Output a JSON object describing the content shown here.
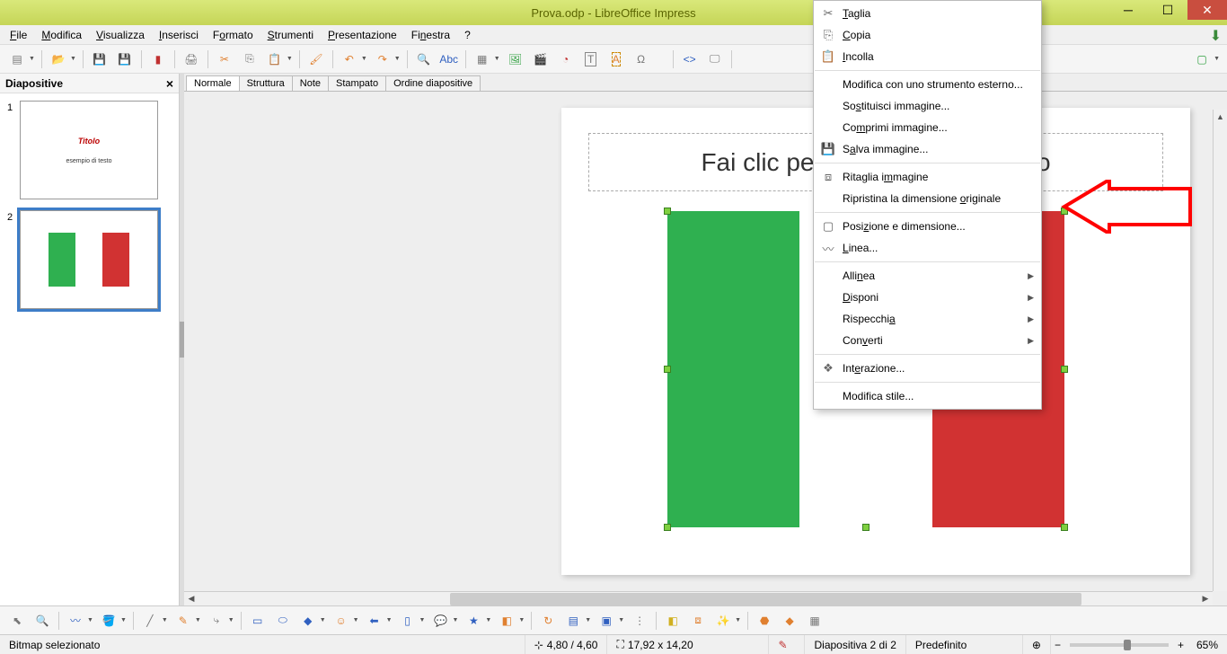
{
  "window": {
    "title": "Prova.odp - LibreOffice Impress"
  },
  "menu": {
    "file": "File",
    "edit": "Modifica",
    "view": "Visualizza",
    "insert": "Inserisci",
    "format": "Formato",
    "tools": "Strumenti",
    "presentation": "Presentazione",
    "window": "Finestra",
    "help": "?"
  },
  "panel": {
    "slides_title": "Diapositive",
    "close": "×"
  },
  "thumbs": {
    "s1_num": "1",
    "s1_title": "Titolo",
    "s1_sub": "esempio di testo",
    "s2_num": "2"
  },
  "tabs": {
    "normal": "Normale",
    "outline": "Struttura",
    "notes": "Note",
    "handout": "Stampato",
    "sorter": "Ordine diapositive"
  },
  "slide": {
    "title_placeholder": "Fai clic per aggiungere un titolo"
  },
  "ctx": {
    "cut": "Taglia",
    "copy": "Copia",
    "paste": "Incolla",
    "edit_ext": "Modifica con uno strumento esterno...",
    "replace": "Sostituisci immagine...",
    "compress": "Comprimi immagine...",
    "save": "Salva immagine...",
    "crop": "Ritaglia immagine",
    "orig": "Ripristina la dimensione originale",
    "pos": "Posizione e dimensione...",
    "line": "Linea...",
    "align": "Allinea",
    "arrange": "Disponi",
    "mirror": "Rispecchia",
    "convert": "Converti",
    "interaction": "Interazione...",
    "style": "Modifica stile..."
  },
  "status": {
    "sel": "Bitmap selezionato",
    "pos": "4,80 / 4,60",
    "size": "17,92 x 14,20",
    "slide": "Diapositiva 2 di 2",
    "layout": "Predefinito",
    "zoom": "65%"
  }
}
